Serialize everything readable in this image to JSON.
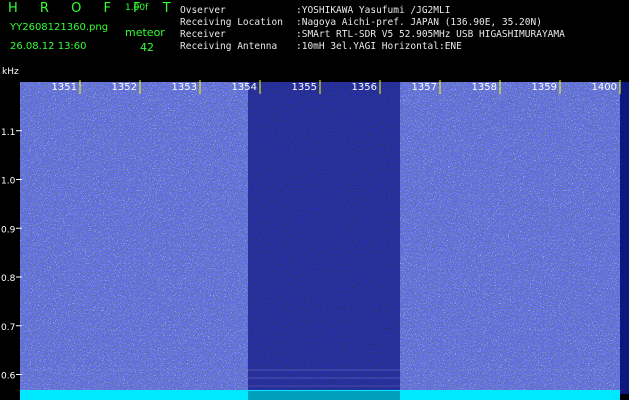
{
  "header": {
    "app_title": "H R O F F T",
    "version": "1.00f",
    "file_name": "YY2608121360.png",
    "datetime": "26.08.12 13:60",
    "meteor_label": "meteor",
    "meteor_count": "42"
  },
  "info": [
    {
      "key": "Ovserver",
      "value": ":YOSHIKAWA Yasufumi /JG2MLI"
    },
    {
      "key": "Receiving Location",
      "value": ":Nagoya Aichi-pref. JAPAN (136.90E, 35.20N)"
    },
    {
      "key": "Receiver",
      "value": ":SMArt RTL-SDR V5 52.905MHz USB HIGASHIMURAYAMA"
    },
    {
      "key": "Receiving Antenna",
      "value": ":10mH 3el.YAGI Horizontal:ENE"
    }
  ],
  "plot": {
    "y_unit": "kHz",
    "y_ticks": [
      "1.1",
      "1.0",
      "0.9",
      "0.8",
      "0.7",
      "0.6"
    ],
    "y_range": [
      0.56,
      1.2
    ],
    "x_ticks": [
      "1351",
      "1352",
      "1353",
      "1354",
      "1355",
      "1356",
      "1357",
      "1358",
      "1359",
      "1400"
    ],
    "colors": {
      "background": "#000000",
      "noise_base": "#1428c8",
      "noise_dim": "#080830",
      "baseline": "#00e8ff",
      "tick": "#ffff00",
      "label": "#ffffff"
    }
  }
}
